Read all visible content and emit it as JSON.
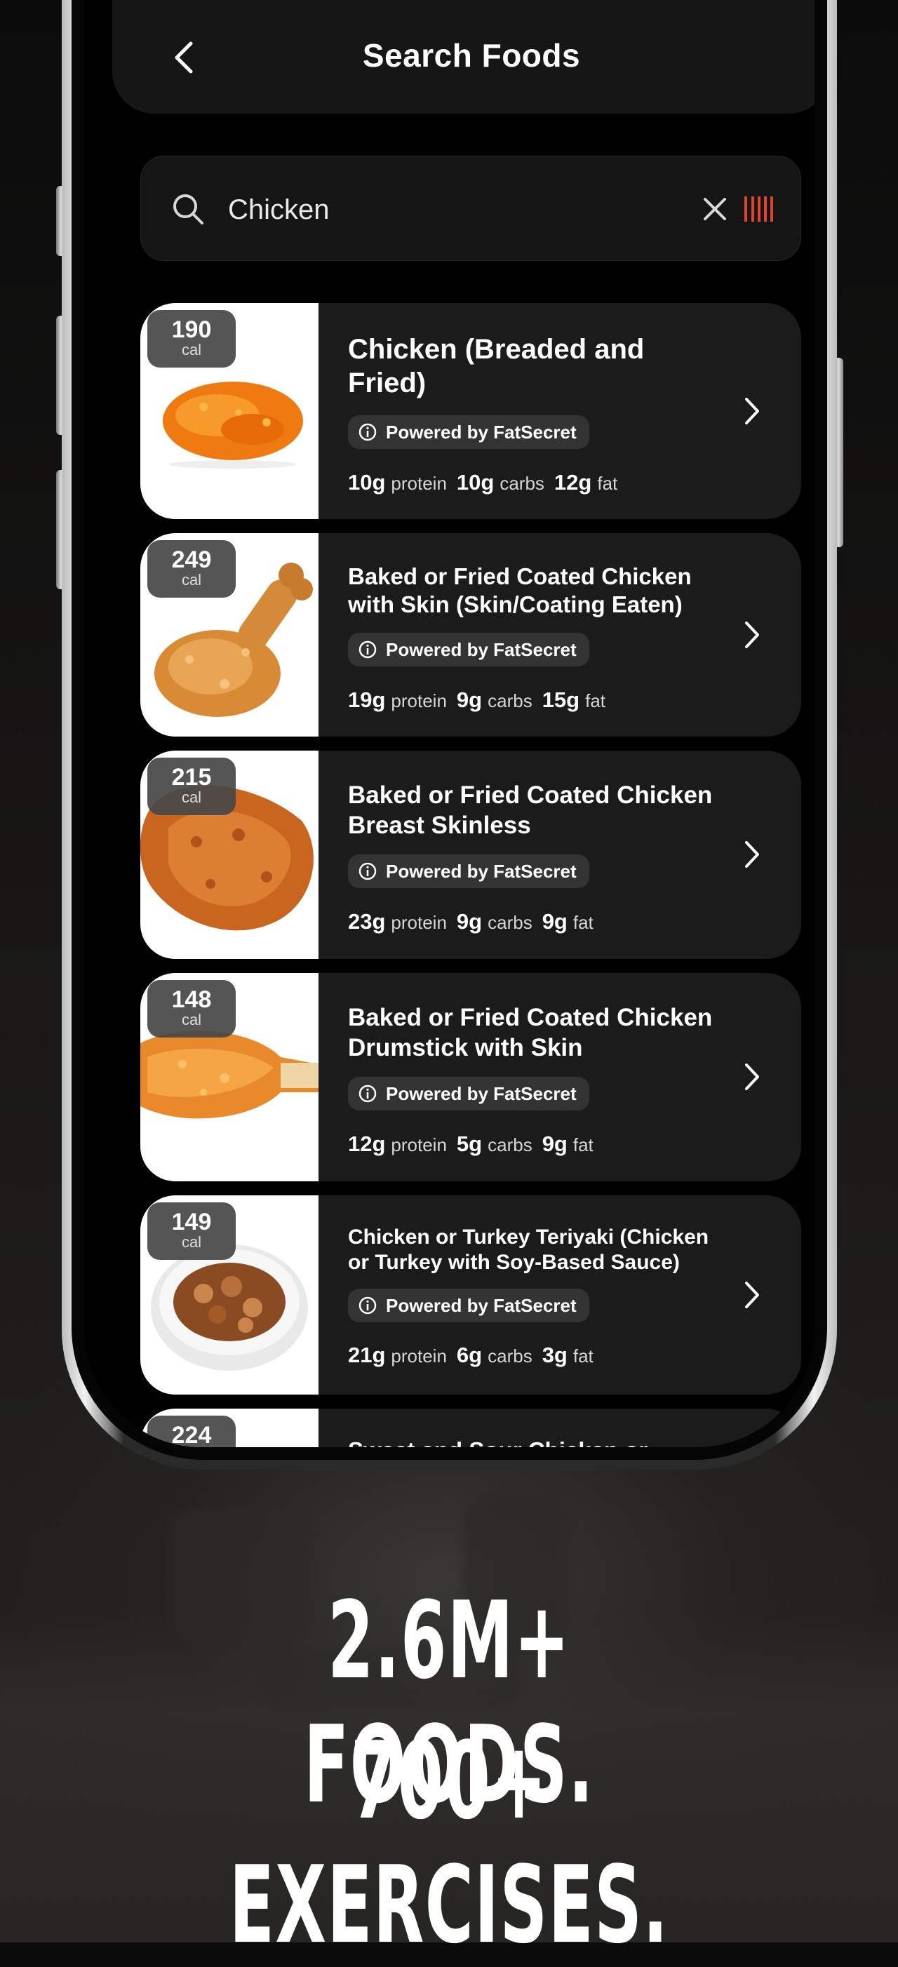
{
  "header": {
    "title": "Search Foods"
  },
  "search": {
    "value": "Chicken",
    "placeholder": ""
  },
  "results": [
    {
      "calories": "190",
      "cal_unit": "cal",
      "name": "Chicken (Breaded and Fried)",
      "source": "Powered by FatSecret",
      "protein": "10g",
      "carbs": "10g",
      "fat": "12g"
    },
    {
      "calories": "249",
      "cal_unit": "cal",
      "name": "Baked or Fried Coated Chicken with Skin (Skin/Coating Eaten)",
      "source": "Powered by FatSecret",
      "protein": "19g",
      "carbs": "9g",
      "fat": "15g"
    },
    {
      "calories": "215",
      "cal_unit": "cal",
      "name": "Baked or Fried Coated Chicken Breast Skinless",
      "source": "Powered by FatSecret",
      "protein": "23g",
      "carbs": "9g",
      "fat": "9g"
    },
    {
      "calories": "148",
      "cal_unit": "cal",
      "name": "Baked or Fried Coated Chicken Drumstick with Skin",
      "source": "Powered by FatSecret",
      "protein": "12g",
      "carbs": "5g",
      "fat": "9g"
    },
    {
      "calories": "149",
      "cal_unit": "cal",
      "name": "Chicken or Turkey Teriyaki (Chicken or Turkey with Soy-Based Sauce)",
      "source": "Powered by FatSecret",
      "protein": "21g",
      "carbs": "6g",
      "fat": "3g"
    },
    {
      "calories": "224",
      "cal_unit": "cal",
      "name": "Sweet and Sour Chicken or"
    }
  ],
  "macro_labels": {
    "protein": "protein",
    "carbs": "carbs",
    "fat": "fat"
  },
  "marketing": {
    "line1": "2.6M+ FOODS.",
    "line2": "700+ EXERCISES."
  },
  "icons": {
    "back": "chevron-left-icon",
    "search": "search-icon",
    "clear": "close-icon",
    "barcode": "barcode-icon",
    "info": "info-icon",
    "row_chevron": "chevron-right-icon"
  },
  "colors": {
    "accent": "#e0452b",
    "card": "#1b1b1b",
    "pill": "#333333"
  }
}
